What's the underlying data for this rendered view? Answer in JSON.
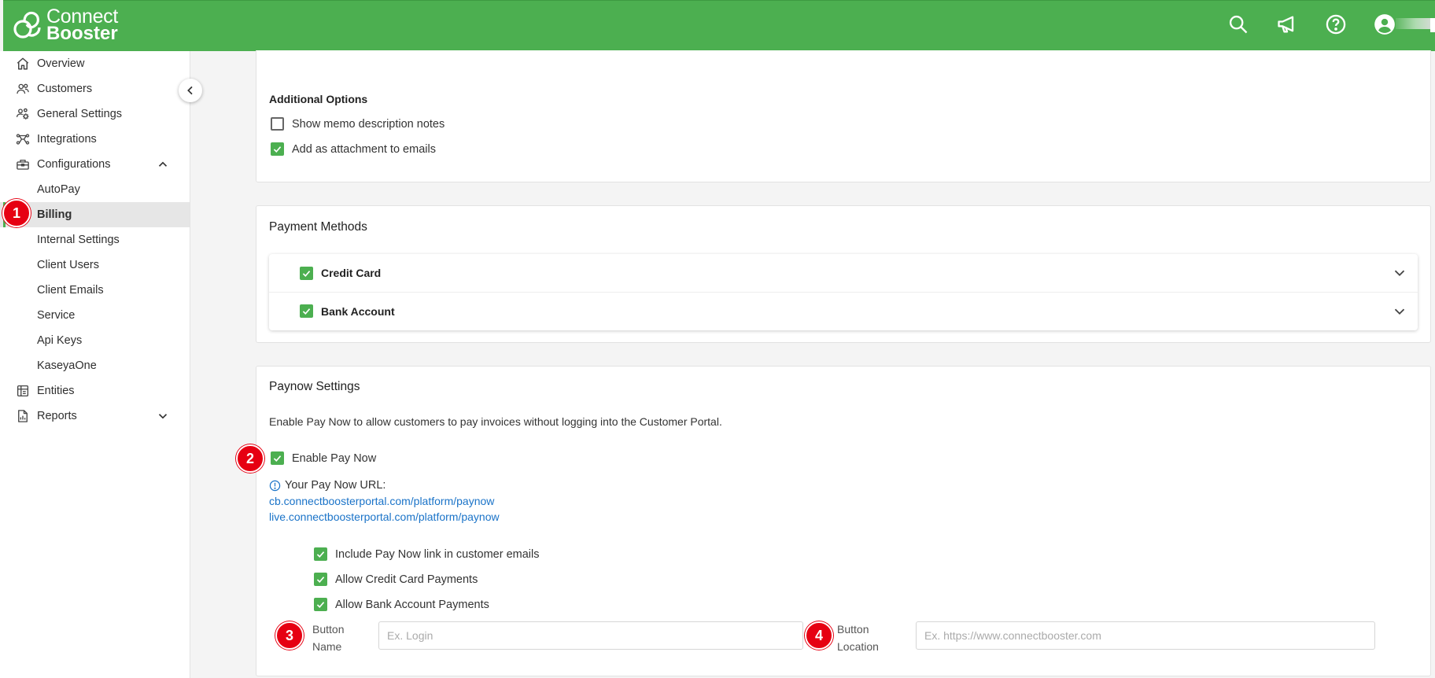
{
  "app": {
    "logo_line1": "Connect",
    "logo_line2": "Booster",
    "brand_color": "#4caf50"
  },
  "topbar": {
    "icons": [
      "search-icon",
      "megaphone-icon",
      "help-icon",
      "account-icon"
    ]
  },
  "sidebar": {
    "items": [
      {
        "label": "Overview",
        "icon": "home-icon"
      },
      {
        "label": "Customers",
        "icon": "customers-icon"
      },
      {
        "label": "General Settings",
        "icon": "users-gear-icon"
      },
      {
        "label": "Integrations",
        "icon": "integrations-icon"
      },
      {
        "label": "Configurations",
        "icon": "toolbox-icon",
        "expanded": true
      },
      {
        "label": "AutoPay"
      },
      {
        "label": "Billing",
        "active": true
      },
      {
        "label": "Internal Settings"
      },
      {
        "label": "Client Users"
      },
      {
        "label": "Client Emails"
      },
      {
        "label": "Service"
      },
      {
        "label": "Api Keys"
      },
      {
        "label": "KaseyaOne"
      },
      {
        "label": "Entities",
        "icon": "table-icon"
      },
      {
        "label": "Reports",
        "icon": "report-icon",
        "expanded": false
      }
    ]
  },
  "badges": [
    "1",
    "2",
    "3",
    "4"
  ],
  "additional_options": {
    "title": "Additional Options",
    "options": [
      {
        "label": "Show memo description notes",
        "checked": false
      },
      {
        "label": "Add as attachment to emails",
        "checked": true
      }
    ]
  },
  "payment_methods": {
    "title": "Payment Methods",
    "items": [
      {
        "label": "Credit Card",
        "checked": true
      },
      {
        "label": "Bank Account",
        "checked": true
      }
    ]
  },
  "paynow": {
    "title": "Paynow Settings",
    "description": "Enable Pay Now to allow customers to pay invoices without logging into the Customer Portal.",
    "enable_label": "Enable Pay Now",
    "enable_checked": true,
    "url_label": "Your Pay Now URL:",
    "urls": [
      "cb.connectboosterportal.com/platform/paynow",
      "live.connectboosterportal.com/platform/paynow"
    ],
    "options": [
      {
        "label": "Include Pay Now link in customer emails",
        "checked": true
      },
      {
        "label": "Allow Credit Card Payments",
        "checked": true
      },
      {
        "label": "Allow Bank Account Payments",
        "checked": true
      }
    ],
    "button_name_label_1": "Button",
    "button_name_label_2": "Name",
    "button_name_placeholder": "Ex. Login",
    "button_name_value": "",
    "button_location_label_1": "Button",
    "button_location_label_2": "Location",
    "button_location_placeholder": "Ex. https://www.connectbooster.com",
    "button_location_value": ""
  }
}
